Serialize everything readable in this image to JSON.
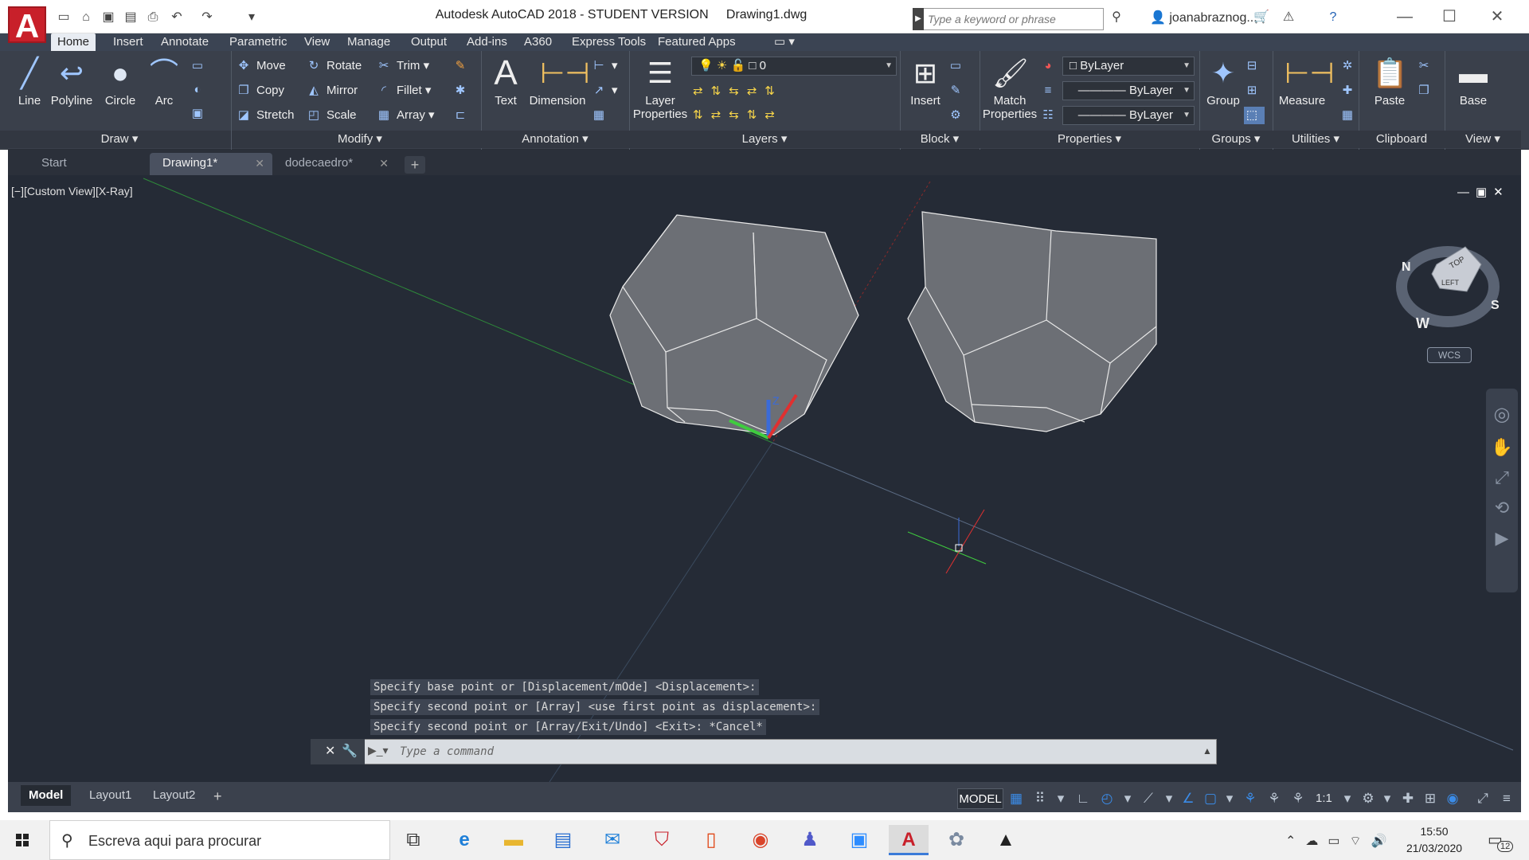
{
  "title": {
    "app": "Autodesk AutoCAD 2018 - STUDENT VERSION",
    "file": "Drawing1.dwg",
    "search_placeholder": "Type a keyword or phrase",
    "user": "joanabraznog..."
  },
  "ribbon_tabs": [
    "Home",
    "Insert",
    "Annotate",
    "Parametric",
    "View",
    "Manage",
    "Output",
    "Add-ins",
    "A360",
    "Express Tools",
    "Featured Apps"
  ],
  "draw": {
    "line": "Line",
    "polyline": "Polyline",
    "circle": "Circle",
    "arc": "Arc",
    "panel": "Draw"
  },
  "modify": {
    "move": "Move",
    "copy": "Copy",
    "stretch": "Stretch",
    "rotate": "Rotate",
    "mirror": "Mirror",
    "scale": "Scale",
    "trim": "Trim",
    "fillet": "Fillet",
    "array": "Array",
    "panel": "Modify"
  },
  "annotation": {
    "text": "Text",
    "dimension": "Dimension",
    "panel": "Annotation"
  },
  "layers": {
    "props_line1": "Layer",
    "props_line2": "Properties",
    "current": "0",
    "panel": "Layers"
  },
  "block": {
    "insert": "Insert",
    "panel": "Block"
  },
  "properties": {
    "match_line1": "Match",
    "match_line2": "Properties",
    "color": "ByLayer",
    "linetype": "ByLayer",
    "lineweight": "ByLayer",
    "panel": "Properties"
  },
  "groups": {
    "group": "Group",
    "panel": "Groups"
  },
  "utilities": {
    "measure": "Measure",
    "panel": "Utilities"
  },
  "clipboard": {
    "paste": "Paste",
    "panel": "Clipboard"
  },
  "viewp": {
    "base": "Base",
    "panel": "View"
  },
  "file_tabs": [
    "Start",
    "Drawing1*",
    "dodecaedro*"
  ],
  "viewport": {
    "label": "[−][Custom View][X-Ray]",
    "wcs": "WCS",
    "cube_top": "TOP",
    "cube_left": "LEFT",
    "compass_n": "N",
    "compass_w": "W",
    "compass_s": "S"
  },
  "command_history": [
    "Specify base point or [Displacement/mOde] <Displacement>:",
    "Specify second point or [Array] <use first point as displacement>:",
    "Specify second point or [Array/Exit/Undo] <Exit>: *Cancel*"
  ],
  "command_placeholder": "Type a command",
  "layout_tabs": [
    "Model",
    "Layout1",
    "Layout2"
  ],
  "status": {
    "model": "MODEL",
    "scale": "1:1"
  },
  "taskbar": {
    "search": "Escreva aqui para procurar",
    "time": "15:50",
    "date": "21/03/2020",
    "notifications": "12"
  }
}
